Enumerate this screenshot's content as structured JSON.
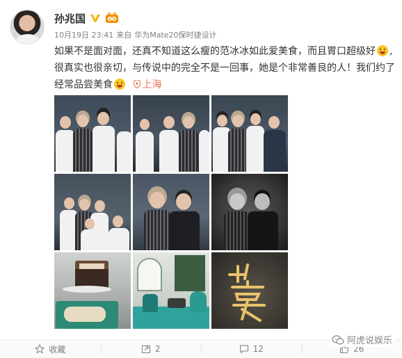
{
  "post": {
    "author": "孙兆国",
    "time": "10月19日 23:41",
    "source_prefix": "来自",
    "source": "华为Mate20保时捷设计",
    "text_line1": "如果不是面对面，还真不知道这么瘦的范冰冰如此爱美食，而且胃口超级好",
    "text_line2": "很真实也很亲切，与传说中的完全不是一回事，她是个非常善良的人！我们约了",
    "text_line3": "经常品尝美食",
    "location": "上海"
  },
  "actions": {
    "favorite": "收藏",
    "repost": "2",
    "comment": "12",
    "like": "26"
  },
  "watermark": "阿虎说娱乐",
  "icons": [
    "verified-v-icon",
    "member-badge-icon",
    "laughing-emoji-icon",
    "location-pin-icon",
    "star-icon",
    "repost-icon",
    "comment-icon",
    "like-icon",
    "wechat-icon"
  ],
  "colors": {
    "verified": "#f5b400",
    "link": "#eb7350",
    "meta": "#808080"
  }
}
